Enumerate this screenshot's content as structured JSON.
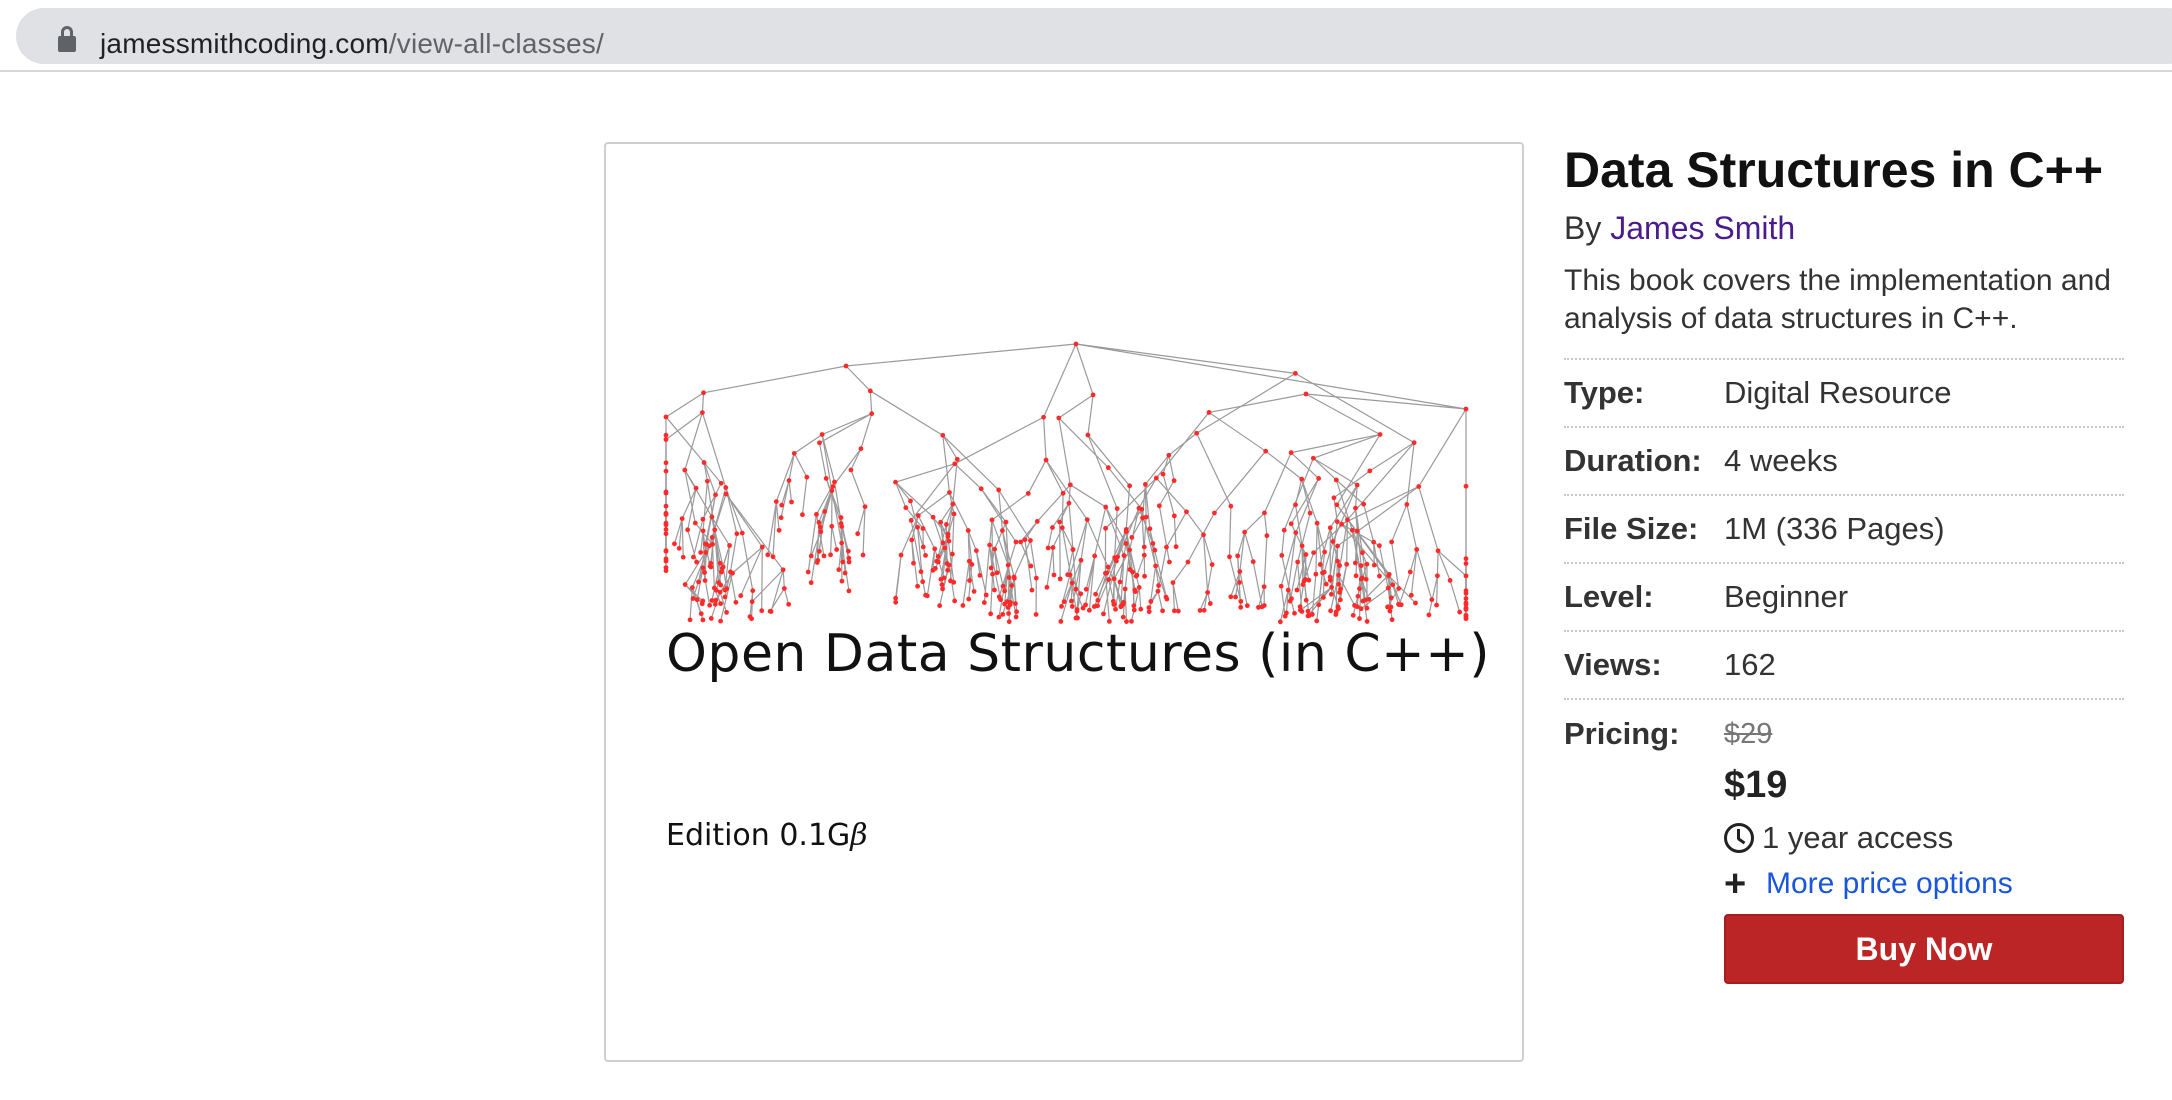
{
  "browser": {
    "url_host": "jamessmithcoding.com",
    "url_path": "/view-all-classes/"
  },
  "cover": {
    "title": "Open Data Structures (in C++)",
    "edition_prefix": "Edition 0.1G",
    "edition_symbol": "β",
    "tree_line_color": "#9a9a9a",
    "tree_node_color": "#ff2a2a"
  },
  "product": {
    "title": "Data Structures in C++",
    "by_prefix": "By",
    "author": "James Smith",
    "description": "This book covers the implementation and analysis of data structures in C++.",
    "attributes": [
      {
        "key": "Type:",
        "value": "Digital Resource"
      },
      {
        "key": "Duration:",
        "value": "4 weeks"
      },
      {
        "key": "File Size:",
        "value": "1M (336 Pages)"
      },
      {
        "key": "Level:",
        "value": "Beginner"
      },
      {
        "key": "Views:",
        "value": "162"
      }
    ],
    "pricing": {
      "label": "Pricing:",
      "old_price": "$29",
      "new_price": "$19",
      "access": "1 year access",
      "more_options": "More price options",
      "buy_label": "Buy Now",
      "buy_color": "#bb2525",
      "link_color": "#1a56db",
      "author_color": "#4a1c8c"
    }
  }
}
